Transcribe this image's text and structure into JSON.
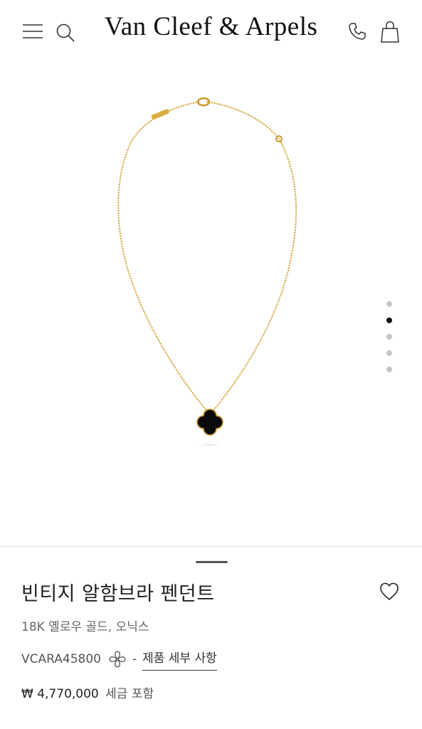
{
  "header": {
    "brand": "Van Cleef & Arpels",
    "icons": [
      "menu-icon",
      "search-icon",
      "phone-icon",
      "shopping-bag-icon"
    ]
  },
  "carousel": {
    "total": 5,
    "active_index": 1
  },
  "product": {
    "title": "빈티지 알함브라 펜던트",
    "material": "18K 옐로우 골드, 오닉스",
    "reference": "VCARA45800",
    "separator": "-",
    "details_link": "제품 세부 사항",
    "price": "₩ 4,770,000",
    "tax_note": "세금 포함"
  },
  "colors": {
    "gold": "#d4a63c",
    "onyx": "#0a0a0a",
    "active_dot": "#111111",
    "inactive_dot": "#c6c6c6"
  }
}
